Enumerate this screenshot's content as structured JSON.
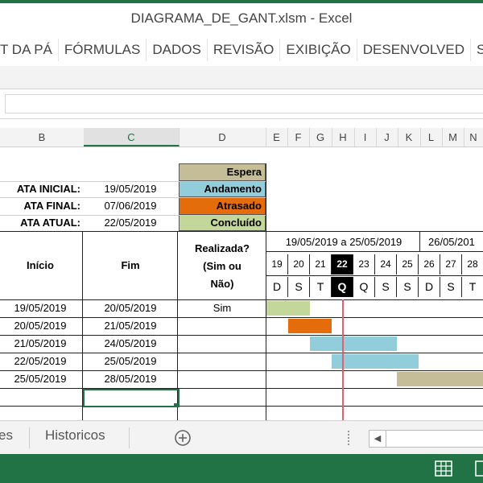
{
  "window": {
    "title": "DIAGRAMA_DE_GANT.xlsm - Excel"
  },
  "ribbon": {
    "tabs": [
      "T DA PÁ",
      "FÓRMULAS",
      "DADOS",
      "REVISÃO",
      "EXIBIÇÃO",
      "DESENVOLVED",
      "SU"
    ]
  },
  "columns": [
    "B",
    "C",
    "D",
    "E",
    "F",
    "G",
    "H",
    "I",
    "J",
    "K",
    "L",
    "M",
    "N"
  ],
  "selected_column": "C",
  "dates": {
    "initial_label": "ATA INICIAL:",
    "initial_value": "19/05/2019",
    "final_label": "ATA FINAL:",
    "final_value": "07/06/2019",
    "current_label": "ATA ATUAL:",
    "current_value": "22/05/2019"
  },
  "legend": [
    {
      "label": "Espera",
      "color": "#c4bd97"
    },
    {
      "label": "Andamento",
      "color": "#92cddc"
    },
    {
      "label": "Atrasado",
      "color": "#e46c0a"
    },
    {
      "label": "Concluído",
      "color": "#c4d79b"
    }
  ],
  "table_headers": {
    "start": "Início",
    "end": "Fim",
    "done_l1": "Realizada?",
    "done_l2": "(Sim ou",
    "done_l3": "Não)"
  },
  "weeks": [
    "19/05/2019 a 25/05/2019",
    "26/05/201"
  ],
  "days": [
    "19",
    "20",
    "21",
    "22",
    "23",
    "24",
    "25",
    "26",
    "27",
    "28"
  ],
  "weekdays": [
    "D",
    "S",
    "T",
    "Q",
    "Q",
    "S",
    "S",
    "D",
    "S",
    "T"
  ],
  "today_index": 3,
  "tasks": [
    {
      "start": "19/05/2019",
      "end": "20/05/2019",
      "done": "Sim",
      "status": "Concluído"
    },
    {
      "start": "20/05/2019",
      "end": "21/05/2019",
      "done": "",
      "status": "Atrasado"
    },
    {
      "start": "21/05/2019",
      "end": "24/05/2019",
      "done": "",
      "status": "Andamento"
    },
    {
      "start": "22/05/2019",
      "end": "25/05/2019",
      "done": "",
      "status": "Andamento"
    },
    {
      "start": "25/05/2019",
      "end": "28/05/2019",
      "done": "",
      "status": "Espera"
    }
  ],
  "sheet_tabs": [
    "es",
    "Historicos"
  ],
  "add_sheet_icon": "plus-circle-icon",
  "status_icons": [
    "normal-view-icon",
    "page-layout-icon"
  ]
}
